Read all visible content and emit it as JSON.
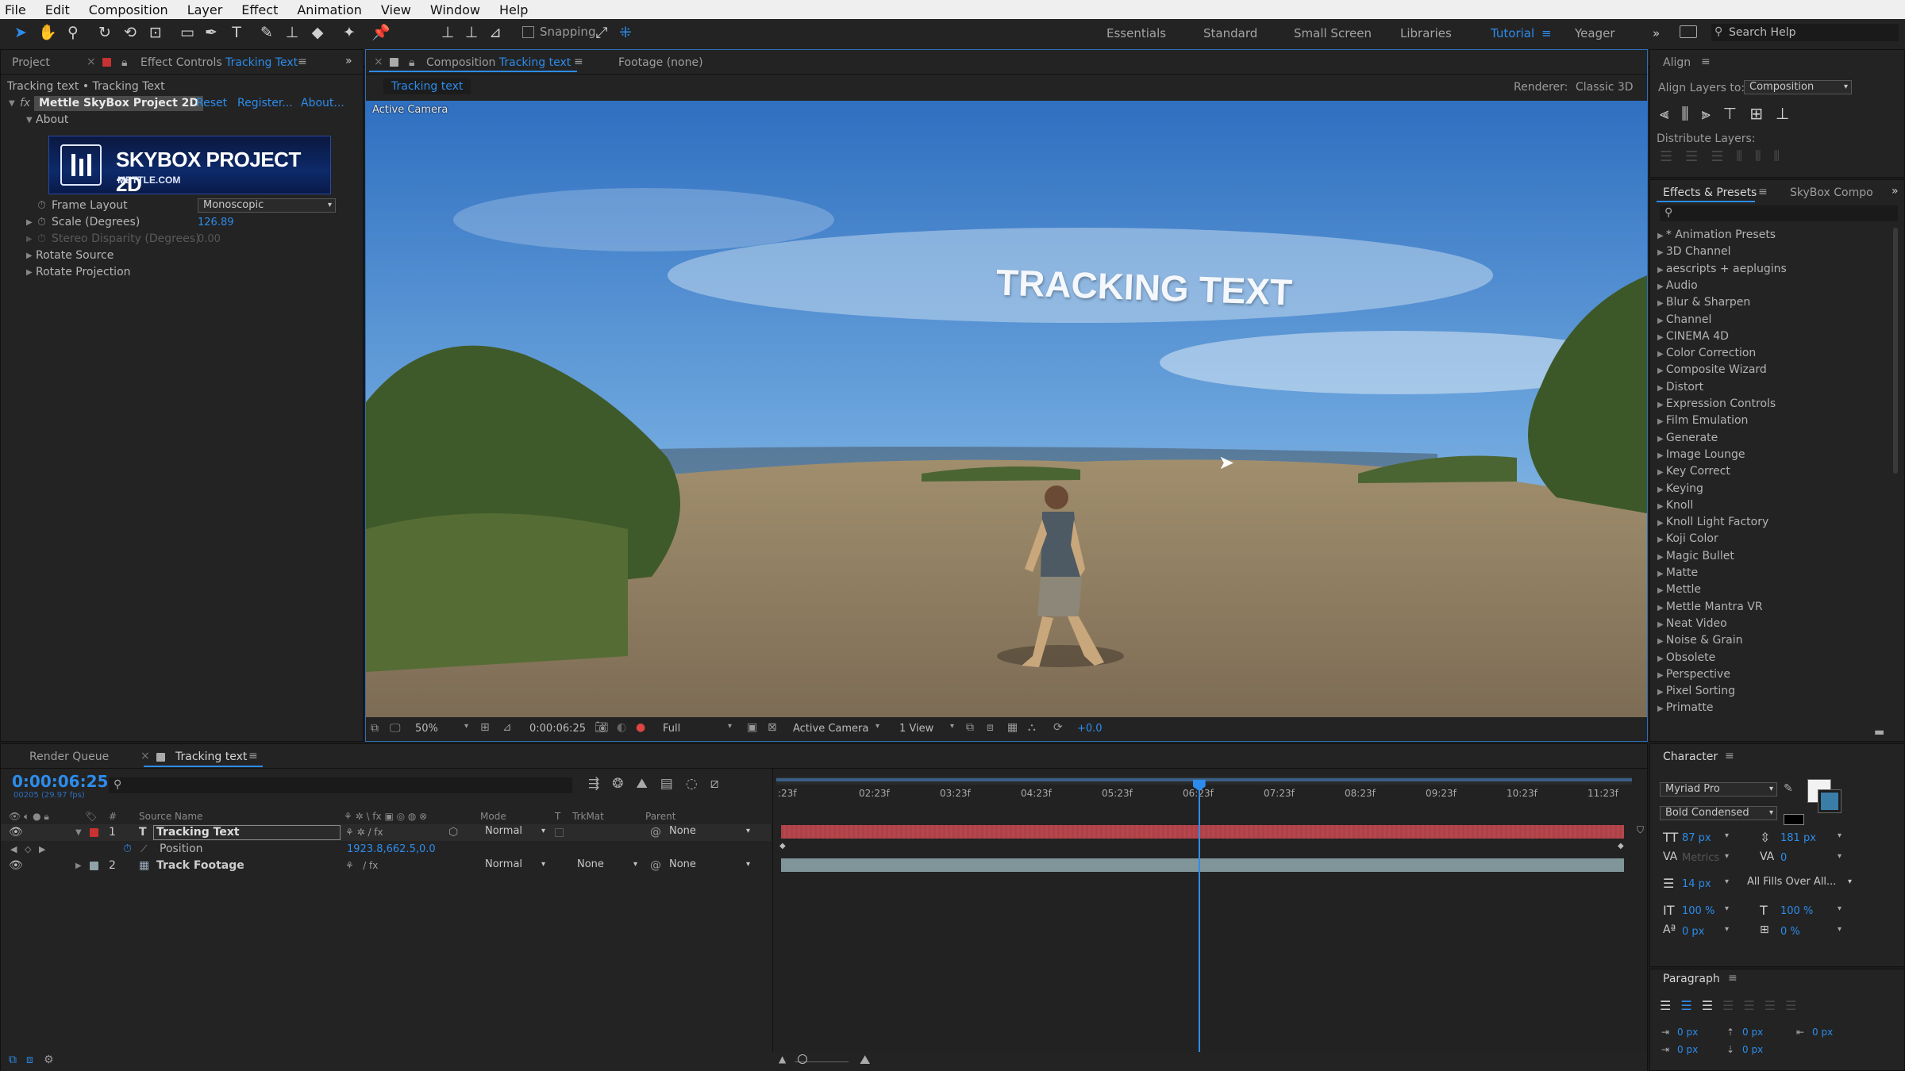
{
  "menu": [
    "File",
    "Edit",
    "Composition",
    "Layer",
    "Effect",
    "Animation",
    "View",
    "Window",
    "Help"
  ],
  "toolbar": {
    "snapping_label": "Snapping",
    "workspaces": [
      "Essentials",
      "Standard",
      "Small Screen",
      "Libraries",
      "Tutorial",
      "Yeager"
    ],
    "active_workspace": "Tutorial",
    "search_placeholder": "Search Help"
  },
  "left_panel": {
    "tab_project": "Project",
    "tab_effect_controls": "Effect Controls",
    "tab_effect_target": "Tracking Text",
    "breadcrumb": "Tracking text • Tracking Text",
    "fx_label": "fx",
    "effect_name": "Mettle SkyBox Project 2D",
    "reset": "Reset",
    "register": "Register...",
    "about": "About...",
    "about_group": "About",
    "banner_title": "SKYBOX PROJECT 2D",
    "banner_sub": "METTLE.COM",
    "properties": [
      {
        "name": "Frame Layout",
        "value": "Monoscopic"
      },
      {
        "name": "Scale (Degrees)",
        "value": "126.89"
      },
      {
        "name": "Stereo Disparity (Degrees)",
        "value": "0.00"
      },
      {
        "name": "Rotate Source",
        "value": ""
      },
      {
        "name": "Rotate Projection",
        "value": ""
      }
    ]
  },
  "viewer": {
    "tab_comp_prefix": "Composition",
    "tab_comp_name": "Tracking text",
    "tab_footage": "Footage (none)",
    "subtab": "Tracking text",
    "renderer_label": "Renderer:",
    "renderer_value": "Classic 3D",
    "active_camera_label": "Active Camera",
    "overlay_text": "TRACKING TEXT",
    "footer": {
      "zoom": "50%",
      "timecode": "0:00:06:25",
      "resolution": "Full",
      "camera": "Active Camera",
      "views": "1 View",
      "exposure": "+0.0"
    }
  },
  "align": {
    "title": "Align",
    "align_to_label": "Align Layers to:",
    "align_to_value": "Composition",
    "distribute_label": "Distribute Layers:"
  },
  "effects_presets": {
    "title": "Effects & Presets",
    "tab2": "SkyBox Compo",
    "items": [
      "* Animation Presets",
      "3D Channel",
      "aescripts + aeplugins",
      "Audio",
      "Blur & Sharpen",
      "Channel",
      "CINEMA 4D",
      "Color Correction",
      "Composite Wizard",
      "Distort",
      "Expression Controls",
      "Film Emulation",
      "Generate",
      "Image Lounge",
      "Key Correct",
      "Keying",
      "Knoll",
      "Knoll Light Factory",
      "Koji Color",
      "Magic Bullet",
      "Matte",
      "Mettle",
      "Mettle Mantra VR",
      "Neat Video",
      "Noise & Grain",
      "Obsolete",
      "Perspective",
      "Pixel Sorting",
      "Primatte"
    ]
  },
  "timeline": {
    "tab_render": "Render Queue",
    "tab_comp": "Tracking text",
    "timecode": "0:00:06:25",
    "sub_timecode": "00205 (29.97 fps)",
    "columns": {
      "source": "Source Name",
      "mode": "Mode",
      "t": "T",
      "trkmat": "TrkMat",
      "parent": "Parent"
    },
    "layers": [
      {
        "num": "1",
        "name": "Tracking Text",
        "mode": "Normal",
        "trkmat": "",
        "parent": "None",
        "color": "#c83232"
      },
      {
        "num": "2",
        "name": "Track Footage",
        "mode": "Normal",
        "trkmat": "None",
        "parent": "None",
        "color": "#8fa3a8"
      }
    ],
    "position_label": "Position",
    "position_value": "1923.8,662.5,0.0",
    "ruler": [
      ":23f",
      "02:23f",
      "03:23f",
      "04:23f",
      "05:23f",
      "06:23f",
      "07:23f",
      "08:23f",
      "09:23f",
      "10:23f",
      "11:23f"
    ],
    "playhead_fraction": 0.495
  },
  "character": {
    "title": "Character",
    "font": "Myriad Pro",
    "style": "Bold Condensed",
    "size": "87 px",
    "leading": "181 px",
    "kerning": "Metrics",
    "tracking": "0",
    "stroke": "14 px",
    "stroke_type": "All Fills Over All...",
    "vscale": "100 %",
    "hscale": "100 %",
    "baseline": "0 px",
    "tsume": "0 %"
  },
  "paragraph": {
    "title": "Paragraph",
    "indents": [
      "0 px",
      "0 px",
      "0 px",
      "0 px",
      "0 px"
    ]
  },
  "colors": {
    "accent": "#2d8ceb",
    "label_red": "#c83232",
    "panel": "#232323"
  }
}
